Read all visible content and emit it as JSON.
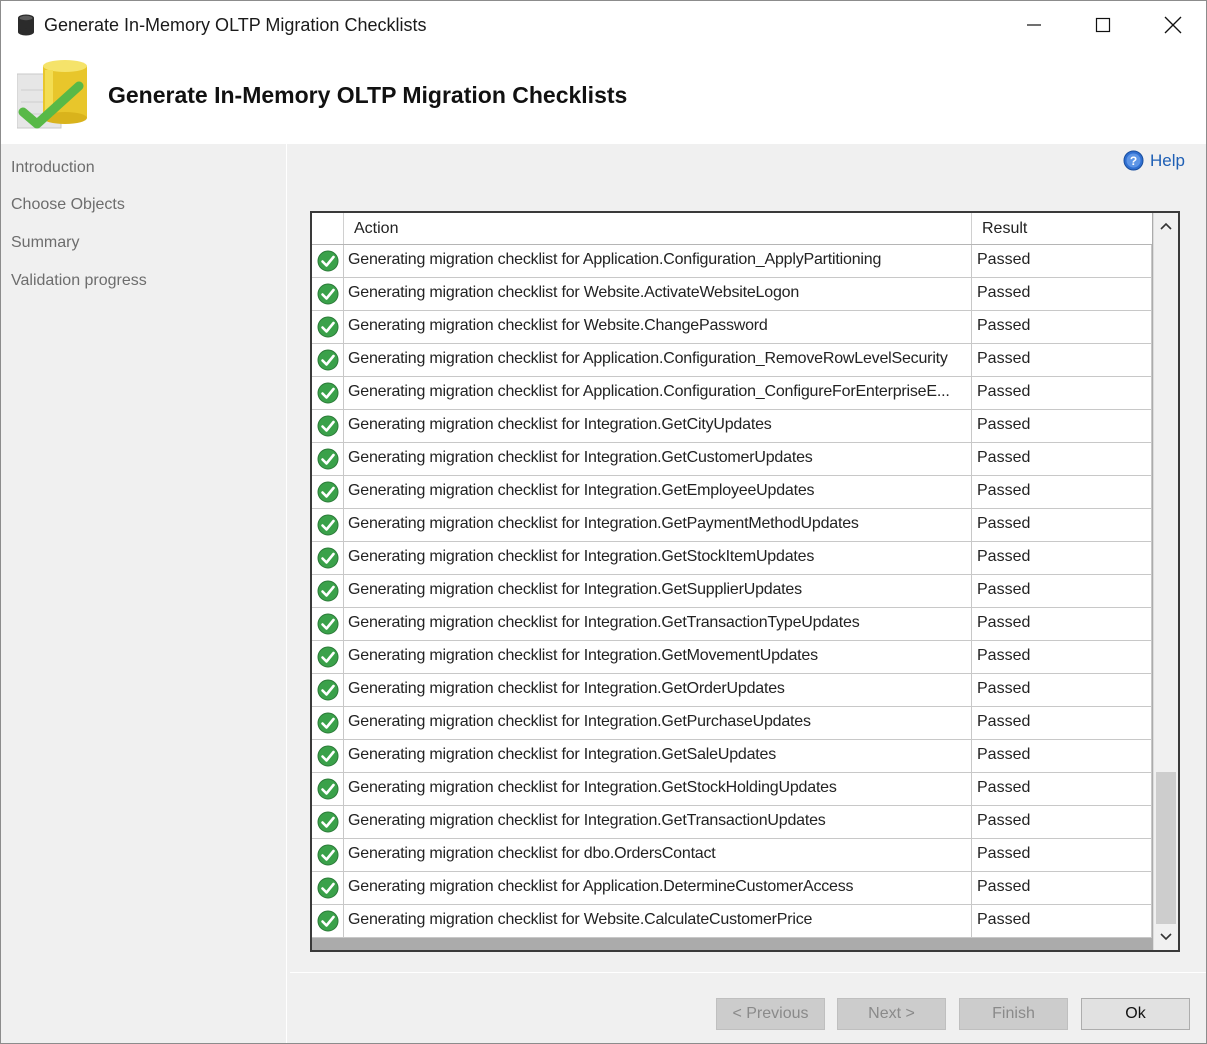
{
  "window": {
    "title": "Generate In-Memory OLTP Migration Checklists"
  },
  "header": {
    "title": "Generate In-Memory OLTP Migration Checklists"
  },
  "nav": {
    "items": [
      {
        "label": "Introduction"
      },
      {
        "label": "Choose Objects"
      },
      {
        "label": "Summary"
      },
      {
        "label": "Validation progress"
      }
    ]
  },
  "help": {
    "label": "Help"
  },
  "grid": {
    "columns": {
      "action": "Action",
      "result": "Result"
    },
    "rows": [
      {
        "action": "Generating migration checklist for Application.Configuration_ApplyPartitioning",
        "result": "Passed"
      },
      {
        "action": "Generating migration checklist for Website.ActivateWebsiteLogon",
        "result": "Passed"
      },
      {
        "action": "Generating migration checklist for Website.ChangePassword",
        "result": "Passed"
      },
      {
        "action": "Generating migration checklist for Application.Configuration_RemoveRowLevelSecurity",
        "result": "Passed"
      },
      {
        "action": "Generating migration checklist for Application.Configuration_ConfigureForEnterpriseE...",
        "result": "Passed"
      },
      {
        "action": "Generating migration checklist for Integration.GetCityUpdates",
        "result": "Passed"
      },
      {
        "action": "Generating migration checklist for Integration.GetCustomerUpdates",
        "result": "Passed"
      },
      {
        "action": "Generating migration checklist for Integration.GetEmployeeUpdates",
        "result": "Passed"
      },
      {
        "action": "Generating migration checklist for Integration.GetPaymentMethodUpdates",
        "result": "Passed"
      },
      {
        "action": "Generating migration checklist for Integration.GetStockItemUpdates",
        "result": "Passed"
      },
      {
        "action": "Generating migration checklist for Integration.GetSupplierUpdates",
        "result": "Passed"
      },
      {
        "action": "Generating migration checklist for Integration.GetTransactionTypeUpdates",
        "result": "Passed"
      },
      {
        "action": "Generating migration checklist for Integration.GetMovementUpdates",
        "result": "Passed"
      },
      {
        "action": "Generating migration checklist for Integration.GetOrderUpdates",
        "result": "Passed"
      },
      {
        "action": "Generating migration checklist for Integration.GetPurchaseUpdates",
        "result": "Passed"
      },
      {
        "action": "Generating migration checklist for Integration.GetSaleUpdates",
        "result": "Passed"
      },
      {
        "action": "Generating migration checklist for Integration.GetStockHoldingUpdates",
        "result": "Passed"
      },
      {
        "action": "Generating migration checklist for Integration.GetTransactionUpdates",
        "result": "Passed"
      },
      {
        "action": "Generating migration checklist for dbo.OrdersContact",
        "result": "Passed"
      },
      {
        "action": "Generating migration checklist for Application.DetermineCustomerAccess",
        "result": "Passed"
      },
      {
        "action": "Generating migration checklist for Website.CalculateCustomerPrice",
        "result": "Passed"
      }
    ]
  },
  "footer": {
    "previous_label": "< Previous",
    "next_label": "Next >",
    "finish_label": "Finish",
    "ok_label": "Ok"
  },
  "colors": {
    "success_green": "#3aa14a",
    "help_blue": "#1e5fb5"
  }
}
